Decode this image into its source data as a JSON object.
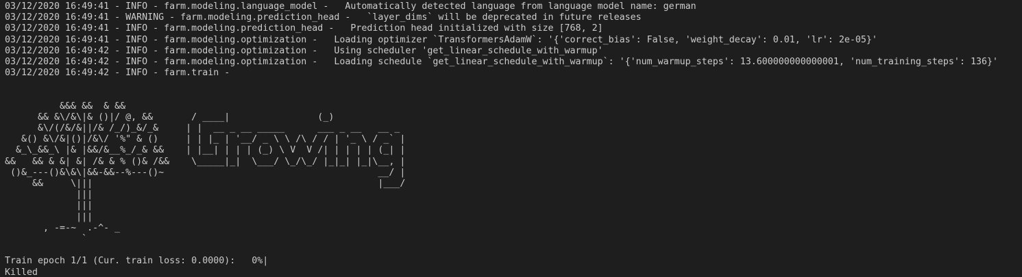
{
  "log_lines": [
    "03/12/2020 16:49:41 - INFO - farm.modeling.language_model -   Automatically detected language from language model name: german",
    "03/12/2020 16:49:41 - WARNING - farm.modeling.prediction_head -   `layer_dims` will be deprecated in future releases",
    "03/12/2020 16:49:41 - INFO - farm.modeling.prediction_head -   Prediction head initialized with size [768, 2]",
    "03/12/2020 16:49:41 - INFO - farm.modeling.optimization -   Loading optimizer `TransformersAdamW`: '{'correct_bias': False, 'weight_decay': 0.01, 'lr': 2e-05}'",
    "03/12/2020 16:49:42 - INFO - farm.modeling.optimization -   Using scheduler 'get_linear_schedule_with_warmup'",
    "03/12/2020 16:49:42 - INFO - farm.modeling.optimization -   Loading schedule `get_linear_schedule_with_warmup`: '{'num_warmup_steps': 13.600000000000001, 'num_training_steps': 136}'",
    "03/12/2020 16:49:42 - INFO - farm.train -"
  ],
  "ascii_art": [
    "          &&& &&  & &&",
    "      && &\\/&\\|& ()|/ @, &&       / ____|                (_)",
    "      &\\/(/&/&||/& /_/)_&/_&     | |  __ _ __ _____      ___ _ __   __ _",
    "   &() &\\/&|()|/&\\/ '%\" & ()     | | |_ | '__/ _ \\ \\ /\\ / / | '_ \\ / _` |",
    "  &_\\_&&_\\ |& |&&/&__%_/_& &&    | |__| | | | (_) \\ V  V /| | | | | (_| |",
    "&&   && & &| &| /& & % ()& /&&    \\_____|_|  \\___/ \\_/\\_/ |_|_| |_|\\__, |",
    " ()&_---()&\\&\\|&&-&&--%---()~                                       __/ |",
    "     &&     \\|||                                                    |___/",
    "             |||",
    "             |||",
    "             |||",
    "       , -=-~  .-^- _",
    "              `"
  ],
  "progress": {
    "label": "Train epoch 1/1 (Cur. train loss: 0.0000):",
    "percent_text": "0%|",
    "percent": 0
  },
  "status": "Killed",
  "cut_off_line": "                                                    ` ` ` ` `",
  "colors": {
    "background": "#1e1e1e",
    "foreground": "#cccccc"
  }
}
